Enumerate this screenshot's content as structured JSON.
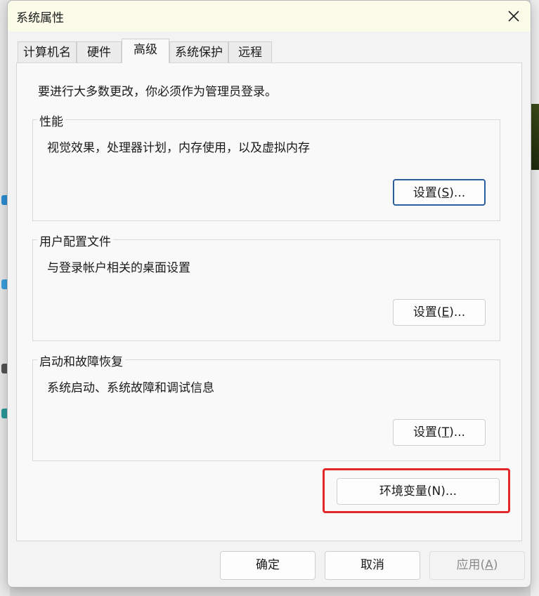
{
  "window": {
    "title": "系统属性"
  },
  "tabs": [
    {
      "label": "计算机名"
    },
    {
      "label": "硬件"
    },
    {
      "label": "高级",
      "active": true
    },
    {
      "label": "系统保护"
    },
    {
      "label": "远程"
    }
  ],
  "admin_note": "要进行大多数更改，你必须作为管理员登录。",
  "groups": {
    "performance": {
      "label": "性能",
      "description": "视觉效果，处理器计划，内存使用，以及虚拟内存",
      "button_text": "设置(",
      "button_key": "S",
      "button_suffix": ")..."
    },
    "user_profiles": {
      "label": "用户配置文件",
      "description": "与登录帐户相关的桌面设置",
      "button_text": "设置(",
      "button_key": "E",
      "button_suffix": ")..."
    },
    "startup_recovery": {
      "label": "启动和故障恢复",
      "description": "系统启动、系统故障和调试信息",
      "button_text": "设置(",
      "button_key": "T",
      "button_suffix": ")..."
    }
  },
  "env_button": "环境变量(N)...",
  "footer": {
    "ok": "确定",
    "cancel": "取消",
    "apply_text": "应用(",
    "apply_key": "A",
    "apply_suffix": ")"
  },
  "colors": {
    "highlight": "#e3262a",
    "focus_border": "#2a5f9e",
    "titlebar": "#fbfbe9"
  },
  "icons": {
    "close": "close-icon"
  }
}
